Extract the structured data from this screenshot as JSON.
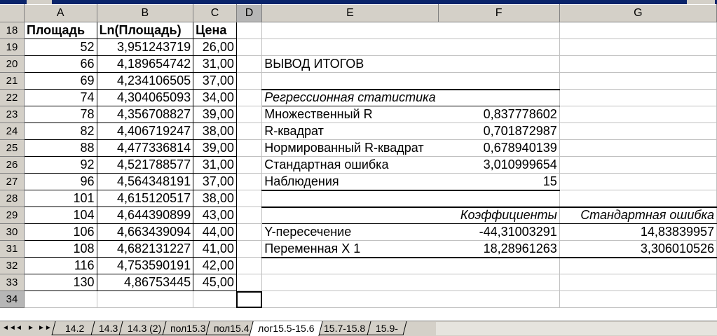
{
  "columns": [
    "A",
    "B",
    "C",
    "D",
    "E",
    "F",
    "G"
  ],
  "rows": [
    {
      "n": "18",
      "a": "Площадь",
      "b": "Ln(Площадь)",
      "c": "Цена",
      "e": "",
      "f": "",
      "g": ""
    },
    {
      "n": "19",
      "a": "52",
      "b": "3,951243719",
      "c": "26,00",
      "e": "",
      "f": "",
      "g": ""
    },
    {
      "n": "20",
      "a": "66",
      "b": "4,189654742",
      "c": "31,00",
      "e": "ВЫВОД ИТОГОВ",
      "f": "",
      "g": ""
    },
    {
      "n": "21",
      "a": "69",
      "b": "4,234106505",
      "c": "37,00",
      "e": "",
      "f": "",
      "g": ""
    },
    {
      "n": "22",
      "a": "74",
      "b": "4,304065093",
      "c": "34,00",
      "e": "Регрессионная статистика",
      "f": "",
      "g": ""
    },
    {
      "n": "23",
      "a": "78",
      "b": "4,356708827",
      "c": "39,00",
      "e": "Множественный R",
      "f": "0,837778602",
      "g": ""
    },
    {
      "n": "24",
      "a": "82",
      "b": "4,406719247",
      "c": "38,00",
      "e": "R-квадрат",
      "f": "0,701872987",
      "g": ""
    },
    {
      "n": "25",
      "a": "88",
      "b": "4,477336814",
      "c": "39,00",
      "e": "Нормированный R-квадрат",
      "f": "0,678940139",
      "g": ""
    },
    {
      "n": "26",
      "a": "92",
      "b": "4,521788577",
      "c": "31,00",
      "e": "Стандартная ошибка",
      "f": "3,010999654",
      "g": ""
    },
    {
      "n": "27",
      "a": "96",
      "b": "4,564348191",
      "c": "37,00",
      "e": "Наблюдения",
      "f": "15",
      "g": ""
    },
    {
      "n": "28",
      "a": "101",
      "b": "4,615120517",
      "c": "38,00",
      "e": "",
      "f": "",
      "g": ""
    },
    {
      "n": "29",
      "a": "104",
      "b": "4,644390899",
      "c": "43,00",
      "e": "",
      "f": "Коэффициенты",
      "g": "Стандартная ошибка"
    },
    {
      "n": "30",
      "a": "106",
      "b": "4,663439094",
      "c": "44,00",
      "e": "Y-пересечение",
      "f": "-44,31003291",
      "g": "14,83839957"
    },
    {
      "n": "31",
      "a": "108",
      "b": "4,682131227",
      "c": "41,00",
      "e": "Переменная X 1",
      "f": "18,28961263",
      "g": "3,306010526"
    },
    {
      "n": "32",
      "a": "116",
      "b": "4,753590191",
      "c": "42,00",
      "e": "",
      "f": "",
      "g": ""
    },
    {
      "n": "33",
      "a": "130",
      "b": "4,86753445",
      "c": "45,00",
      "e": "",
      "f": "",
      "g": ""
    },
    {
      "n": "34",
      "a": "",
      "b": "",
      "c": "",
      "e": "",
      "f": "",
      "g": ""
    }
  ],
  "sheet_tabs": [
    "14.2",
    "14.3",
    "14.3 (2)",
    "пол15.3",
    "пол15.4",
    "лог15.5-15.6",
    "15.7-15.8",
    "15.9-"
  ],
  "active_sheet": "лог15.5-15.6",
  "nav_buttons": [
    "◄◄",
    "◄",
    "►",
    "►►"
  ],
  "active_cell": "D34",
  "colors": {
    "header_bg": "#d4d0c8",
    "selected_header_bg": "#b6b6b6",
    "gridline": "#c0c0c0"
  }
}
